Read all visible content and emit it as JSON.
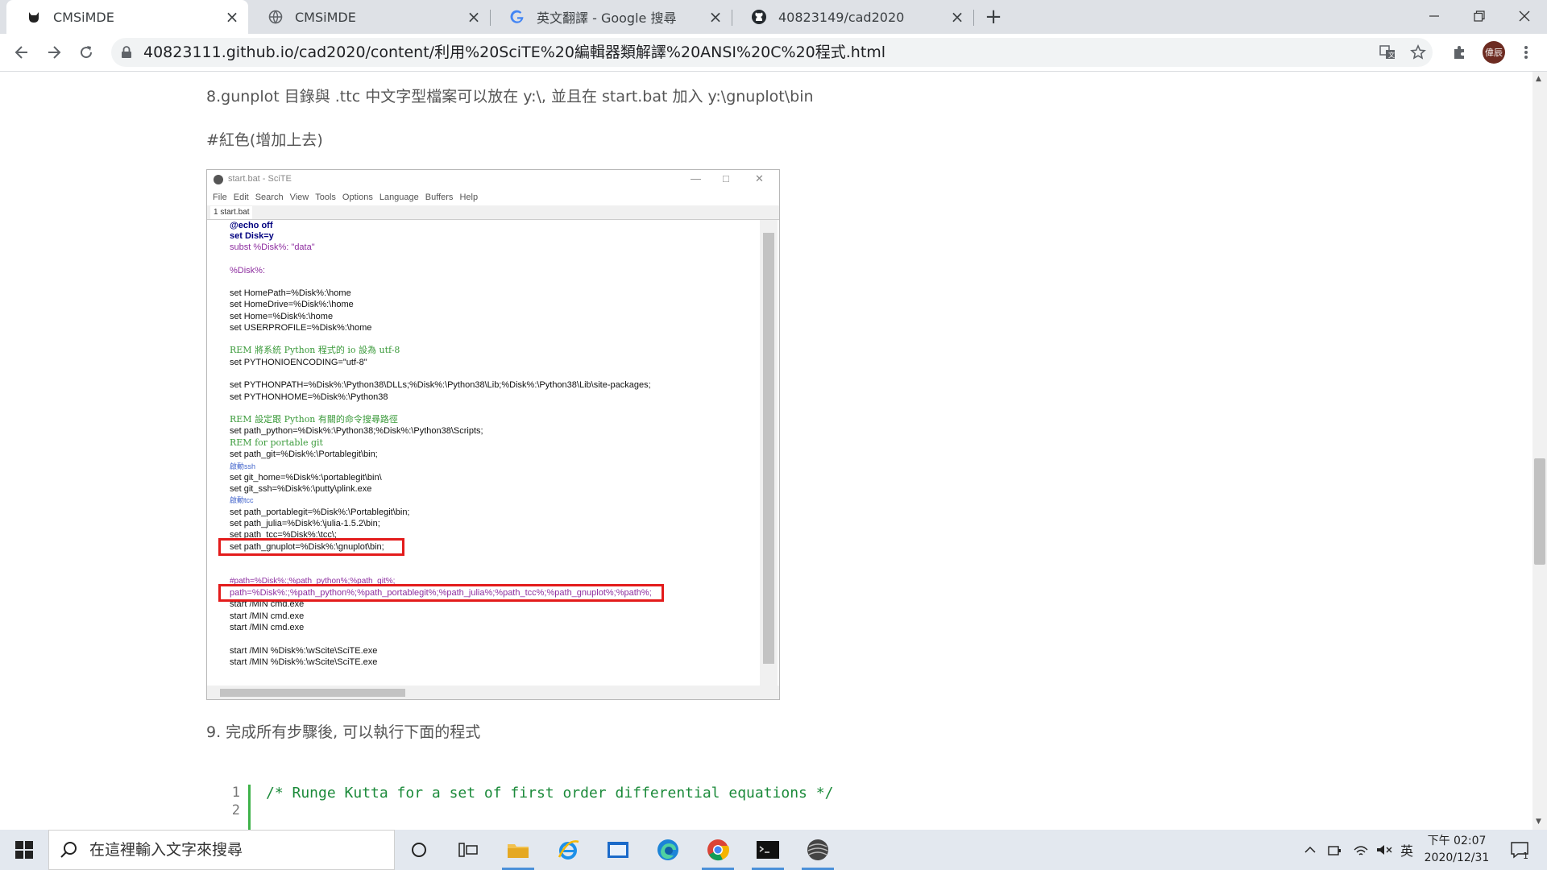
{
  "tabs": [
    {
      "title": "CMSiMDE",
      "favicon": "cat-icon",
      "active": true
    },
    {
      "title": "CMSiMDE",
      "favicon": "globe-icon",
      "active": false
    },
    {
      "title": "英文翻譯 - Google 搜尋",
      "favicon": "google-icon",
      "active": false
    },
    {
      "title": "40823149/cad2020",
      "favicon": "github-icon",
      "active": false
    }
  ],
  "address": {
    "url": "40823111.github.io/cad2020/content/利用%20SciTE%20編輯器類解譯%20ANSI%20C%20程式.html"
  },
  "profile": {
    "avatar_label": "偉辰"
  },
  "content": {
    "p8": "8.gunplot 目錄與 .ttc 中文字型檔案可以放在 y:\\, 並且在 start.bat 加入 y:\\gnuplot\\bin",
    "red_note": "#紅色(增加上去)",
    "p9": "9. 完成所有步驟後, 可以執行下面的程式"
  },
  "scite": {
    "title": "start.bat - SciTE",
    "menu": [
      "File",
      "Edit",
      "Search",
      "View",
      "Tools",
      "Options",
      "Language",
      "Buffers",
      "Help"
    ],
    "tab": "1 start.bat",
    "code": {
      "l1": "@echo off",
      "l2": "set Disk=y",
      "l3": "subst %Disk%: \"data\"",
      "l4": "%Disk%:",
      "l5": "set HomePath=%Disk%:\\home",
      "l6": "set HomeDrive=%Disk%:\\home",
      "l7": "set Home=%Disk%:\\home",
      "l8": "set USERPROFILE=%Disk%:\\home",
      "l9": "REM 將系統 Python 程式的 io 設為 utf-8",
      "l10": "set PYTHONIOENCODING=\"utf-8\"",
      "l11": "set PYTHONPATH=%Disk%:\\Python38\\DLLs;%Disk%:\\Python38\\Lib;%Disk%:\\Python38\\Lib\\site-packages;",
      "l12": "set PYTHONHOME=%Disk%:\\Python38",
      "l13": "REM 設定跟 Python 有關的命令搜尋路徑",
      "l14": "set path_python=%Disk%:\\Python38;%Disk%:\\Python38\\Scripts;",
      "l15": "REM for portable git",
      "l16": "set path_git=%Disk%:\\Portablegit\\bin;",
      "l17": "啟動ssh",
      "l18": "set git_home=%Disk%:\\portablegit\\bin\\",
      "l19": "set git_ssh=%Disk%:\\putty\\plink.exe",
      "l20": "啟動tcc",
      "l21": "set path_portablegit=%Disk%:\\Portablegit\\bin;",
      "l22": "set path_julia=%Disk%:\\julia-1.5.2\\bin;",
      "l23": "set path_tcc=%Disk%:\\tcc\\;",
      "l24": "set path_gnuplot=%Disk%:\\gnuplot\\bin;",
      "l25": "#path=%Disk%:;%path_python%;%path_git%;",
      "l26": "path=%Disk%:;%path_python%;%path_portablegit%;%path_julia%;%path_tcc%;%path_gnuplot%;%path%;",
      "l27": "start /MIN cmd.exe",
      "l28": "start /MIN cmd.exe",
      "l29": "start /MIN cmd.exe",
      "l30": "start /MIN %Disk%:\\wScite\\SciTE.exe",
      "l31": "start /MIN %Disk%:\\wScite\\SciTE.exe"
    }
  },
  "codeblock": {
    "line_numbers": [
      "1",
      "2"
    ],
    "line1": "/* Runge Kutta for a set of first order differential equations */"
  },
  "taskbar": {
    "search_placeholder": "在這裡輸入文字來搜尋",
    "ime": "英",
    "time": "下午 02:07",
    "date": "2020/12/31",
    "notification_count": "1"
  },
  "colors": {
    "highlight": "#e31b1b",
    "code_comment": "#1b8a3a",
    "tab_strip": "#dee1e6"
  }
}
